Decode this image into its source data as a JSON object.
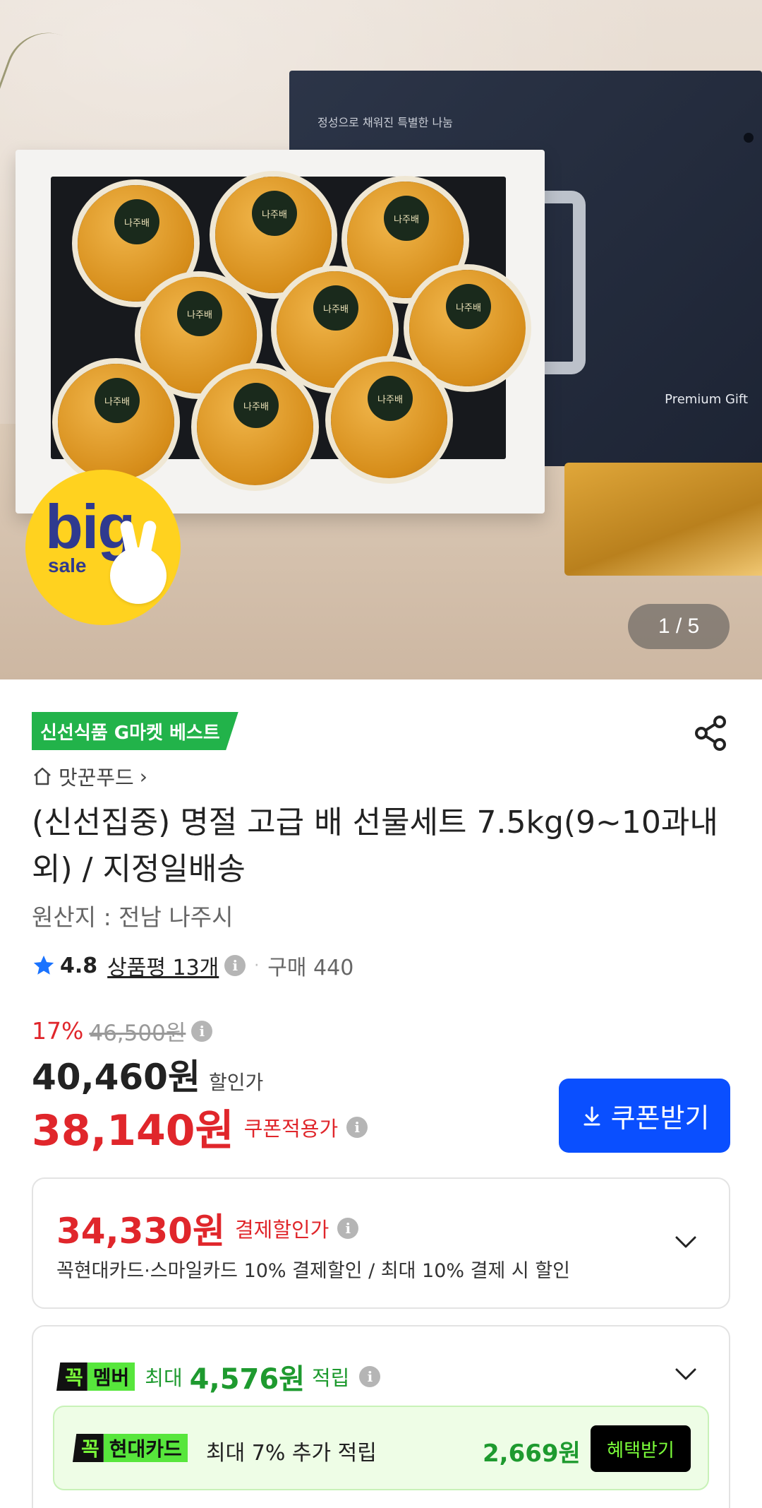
{
  "hero": {
    "box_tagline": "정성으로 채워진 특별한 나눔",
    "box_brand": "Premium Gift",
    "sticker_text": "나주배",
    "badge_big": "big",
    "badge_sale": "sale",
    "image_counter": "1 / 5"
  },
  "product": {
    "best_badge": "신선식품 G마켓 베스트",
    "store_name": "맛꾼푸드",
    "title": "(신선집중) 명절 고급 배 선물세트 7.5kg(9~10과내외) / 지정일배송",
    "origin": "원산지 : 전남 나주시",
    "rating": "4.8",
    "reviews": "상품평 13개",
    "purchases": "구매 440"
  },
  "price": {
    "discount_pct": "17%",
    "original": "46,500원",
    "sale_amount": "40,460원",
    "sale_label": "할인가",
    "coupon_amount": "38,140원",
    "coupon_label": "쿠폰적용가",
    "coupon_button": "쿠폰받기"
  },
  "payment_discount": {
    "amount": "34,330원",
    "label": "결제할인가",
    "description": "꼭현대카드·스마일카드 10% 결제할인 / 최대 10% 결제 시 할인"
  },
  "member": {
    "tag_kk": "꼭",
    "tag_name": "멤버",
    "max_label": "최대",
    "points": "4,576원",
    "accrue_label": "적립",
    "card_tag_kk": "꼭",
    "card_tag_name": "현대카드",
    "card_text": "최대 7% 추가 적립",
    "card_amount": "2,669원",
    "benefit_button": "혜택받기"
  },
  "colors": {
    "accent_red": "#e0262b",
    "accent_blue": "#0a4fff",
    "accent_green": "#1e9a2f",
    "badge_green": "#22b34a"
  },
  "icons": {
    "share": "share-icon",
    "home": "home-icon",
    "star": "star-icon",
    "info": "info-icon",
    "download": "download-icon",
    "chevron": "chevron-down-icon"
  }
}
